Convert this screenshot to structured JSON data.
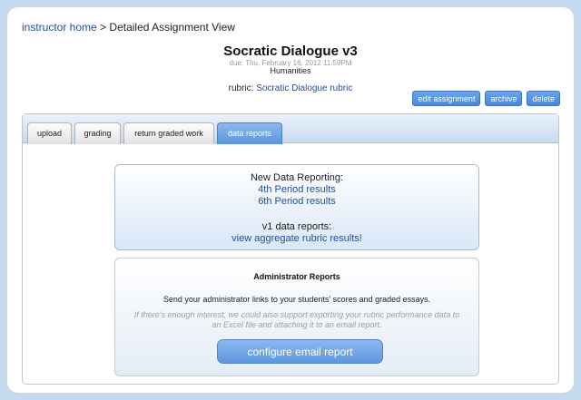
{
  "breadcrumb": {
    "home_link": "instructor home",
    "separator": ">",
    "current": "Detailed Assignment View"
  },
  "assignment": {
    "title": "Socratic Dialogue v3",
    "due": "due: Thu, February 16, 2012 11:59PM",
    "subject": "Humanities",
    "rubric_label": "rubric:",
    "rubric_link": "Socratic Dialogue rubric"
  },
  "actions": {
    "edit": "edit assignment",
    "archive": "archive",
    "delete": "delete"
  },
  "tabs": [
    {
      "label": "upload",
      "active": false
    },
    {
      "label": "grading",
      "active": false
    },
    {
      "label": "return graded work",
      "active": false
    },
    {
      "label": "data reports",
      "active": true
    }
  ],
  "reports": {
    "new_heading": "New Data Reporting:",
    "period4": "4th Period results",
    "period6": "6th Period results",
    "v1_heading": "v1 data reports:",
    "aggregate_link": "view aggregate rubric results!"
  },
  "admin": {
    "title": "Administrator Reports",
    "description": "Send your administrator links to your students' scores and graded essays.",
    "note": "If there's enough interest, we could also support exporting your rubric performance data to an Excel file and attaching it to an email report.",
    "button": "configure email report"
  },
  "colors": {
    "link": "#1f4fa0",
    "button_blue": "#5d95db",
    "background": "#c5d9ee"
  }
}
